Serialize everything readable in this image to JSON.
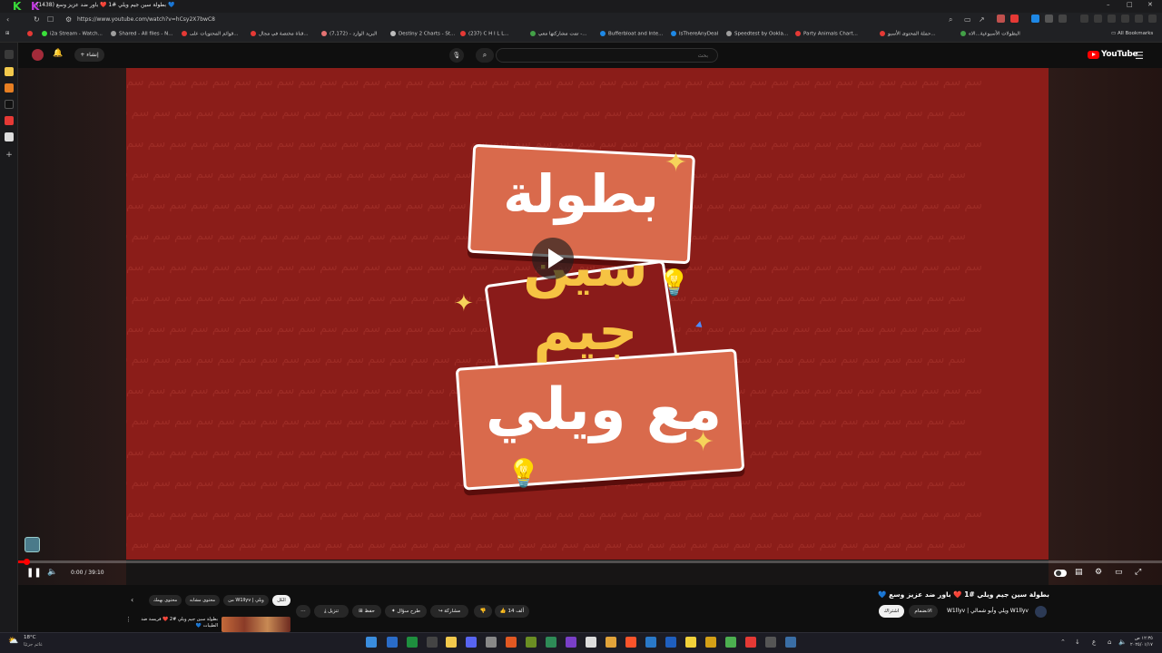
{
  "browser": {
    "tab_title": "(1438) بطولة سين جيم ويلي #1 ❤️ باور ضد عزيز وسع 💙",
    "url": "https://www.youtube.com/watch?v=hCsy2X7bwC8",
    "all_bookmarks": "All Bookmarks",
    "bookmarks": [
      {
        "label": "i2a Stream - Watch...",
        "color": "#e53935"
      },
      {
        "label": "Shared - All files - N...",
        "color": "#9e9e9e"
      },
      {
        "label": "قوائم المحتويات على...",
        "color": "#e53935"
      },
      {
        "label": "قناة مختصة في مجال...",
        "color": "#e53935"
      },
      {
        "label": "البريد الوارد - (7,172)",
        "color": "#e57373"
      },
      {
        "label": "Destiny 2 Charts - St...",
        "color": "#bdbdbd"
      },
      {
        "label": "(237) C H I L L...",
        "color": "#e53935"
      },
      {
        "label": "تمت مشاركتها معي -...",
        "color": "#43a047"
      },
      {
        "label": "Bufferbloat and Inte...",
        "color": "#1e88e5"
      },
      {
        "label": "IsThereAnyDeal",
        "color": "#1e88e5"
      },
      {
        "label": "Speedtest by Ookla...",
        "color": "#9e9e9e"
      },
      {
        "label": "Party Animals Chart...",
        "color": "#e53935"
      },
      {
        "label": "حملة المحتوى الأسبو...",
        "color": "#e53935"
      },
      {
        "label": "البطولات الأسبوعية...الاه",
        "color": "#43a047"
      }
    ]
  },
  "youtube": {
    "logo_text": "YouTube",
    "search_placeholder": "بحث",
    "create_label": "إنشاء",
    "search_icon": "search-icon",
    "mic_icon": "mic-icon"
  },
  "player": {
    "time_display": "0:00 / 39:10",
    "progress": 0.005,
    "pattern_glyph": "سم",
    "poster_words": [
      "بطولة",
      "سين",
      "جيم",
      "مع ويلي"
    ]
  },
  "video": {
    "title": "بطولة سين جيم ويلي #1 ❤️ باور ضد عزيز وسع 💙",
    "channel": "W1llyv | ويلي وأبو شمالي W1llyv",
    "subscribe": "اشتراك",
    "join": "الانضمام",
    "likes": "14 ألف",
    "share": "مشاركة",
    "ask": "طرح سؤال",
    "save": "حفظ",
    "download": "تنزيل"
  },
  "chips": [
    "الكل",
    "من W1llyv | ويلي",
    "محتوى مشابه",
    "محتوى يهمك"
  ],
  "side_video": {
    "title": "بطولة سين جيم ويلي #2 ❤️ فريسة ضد الطيبات 💙"
  },
  "taskbar": {
    "temperature": "18°C",
    "weather": "غائم جزئيًا",
    "time": "١٢:٣٥ ص",
    "date": "٢٠٢٥/٠١/١٧"
  }
}
